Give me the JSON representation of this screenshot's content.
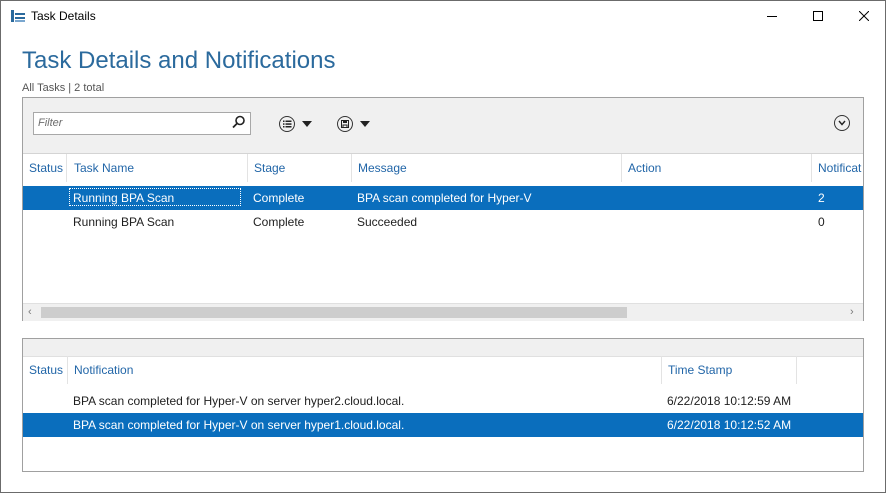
{
  "window": {
    "title": "Task Details"
  },
  "page": {
    "heading": "Task Details and Notifications",
    "subheading": "All Tasks | 2 total"
  },
  "toolbar": {
    "filter_placeholder": "Filter"
  },
  "tasks": {
    "columns": [
      "Status",
      "Task Name",
      "Stage",
      "Message",
      "Action",
      "Notificat"
    ],
    "rows": [
      {
        "status": "",
        "task_name": "Running BPA Scan",
        "stage": "Complete",
        "message": "BPA scan completed for Hyper-V",
        "action": "",
        "notifications": "2",
        "selected": true
      },
      {
        "status": "",
        "task_name": "Running BPA Scan",
        "stage": "Complete",
        "message": "Succeeded",
        "action": "",
        "notifications": "0",
        "selected": false
      }
    ]
  },
  "notifications": {
    "columns": [
      "Status",
      "Notification",
      "Time Stamp"
    ],
    "rows": [
      {
        "status": "",
        "notification": "BPA scan completed for Hyper-V on server hyper2.cloud.local.",
        "timestamp": "6/22/2018 10:12:59 AM",
        "selected": false
      },
      {
        "status": "",
        "notification": "BPA scan completed for Hyper-V on server hyper1.cloud.local.",
        "timestamp": "6/22/2018 10:12:52 AM",
        "selected": true
      }
    ]
  },
  "colors": {
    "accent": "#2b6a9d",
    "selection": "#0a6ebd",
    "header_text": "#2266a8"
  }
}
